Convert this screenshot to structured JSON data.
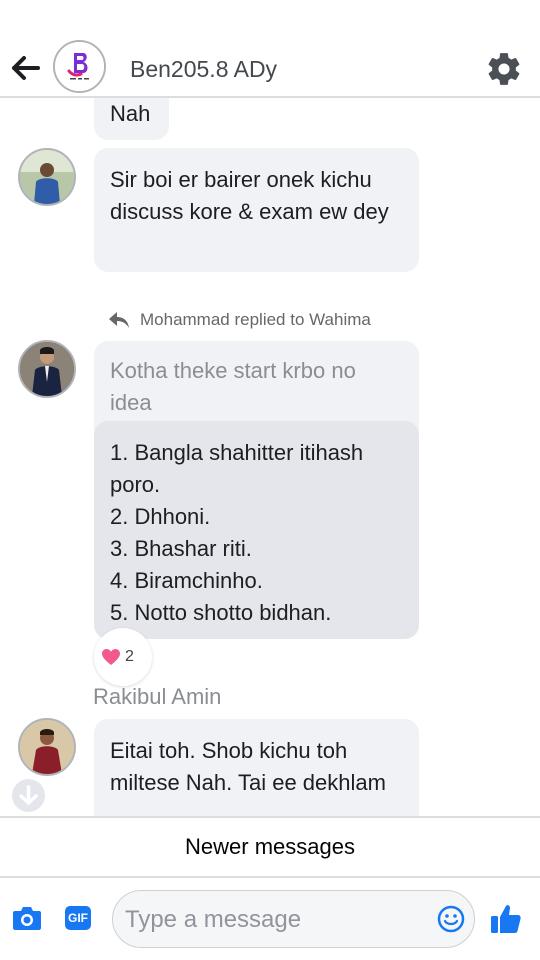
{
  "header": {
    "group_name": "Ben205.8 ADy",
    "back_icon": "arrow-left-icon",
    "settings_icon": "gear-icon"
  },
  "messages": [
    {
      "text": "Nah"
    },
    {
      "text": "Sir boi er bairer onek kichu discuss kore & exam ew dey"
    },
    {
      "quoted_text": "Kotha theke start krbo no idea"
    },
    {
      "lines": [
        "1. Bangla shahitter itihash poro.",
        "2. Dhhoni.",
        "3. Bhashar riti.",
        "4. Biramchinho.",
        "5. Notto shotto bidhan."
      ]
    },
    {
      "text": "Eitai toh. Shob kichu toh miltese Nah. Tai ee dekhlam"
    }
  ],
  "reply_note": "Mohammad replied to Wahima",
  "reaction": {
    "count": "2",
    "icon": "heart-icon"
  },
  "sender_name": "Rakibul Amin",
  "newer_messages_label": "Newer messages",
  "composer": {
    "placeholder": "Type a message",
    "icons": [
      "camera-icon",
      "gif-icon",
      "emoji-icon",
      "thumbs-up-icon"
    ]
  },
  "colors": {
    "accent": "#1877f2",
    "bubble": "#f1f2f6",
    "bubble_dark": "#e4e6eb",
    "heart": "#f25a8c"
  }
}
